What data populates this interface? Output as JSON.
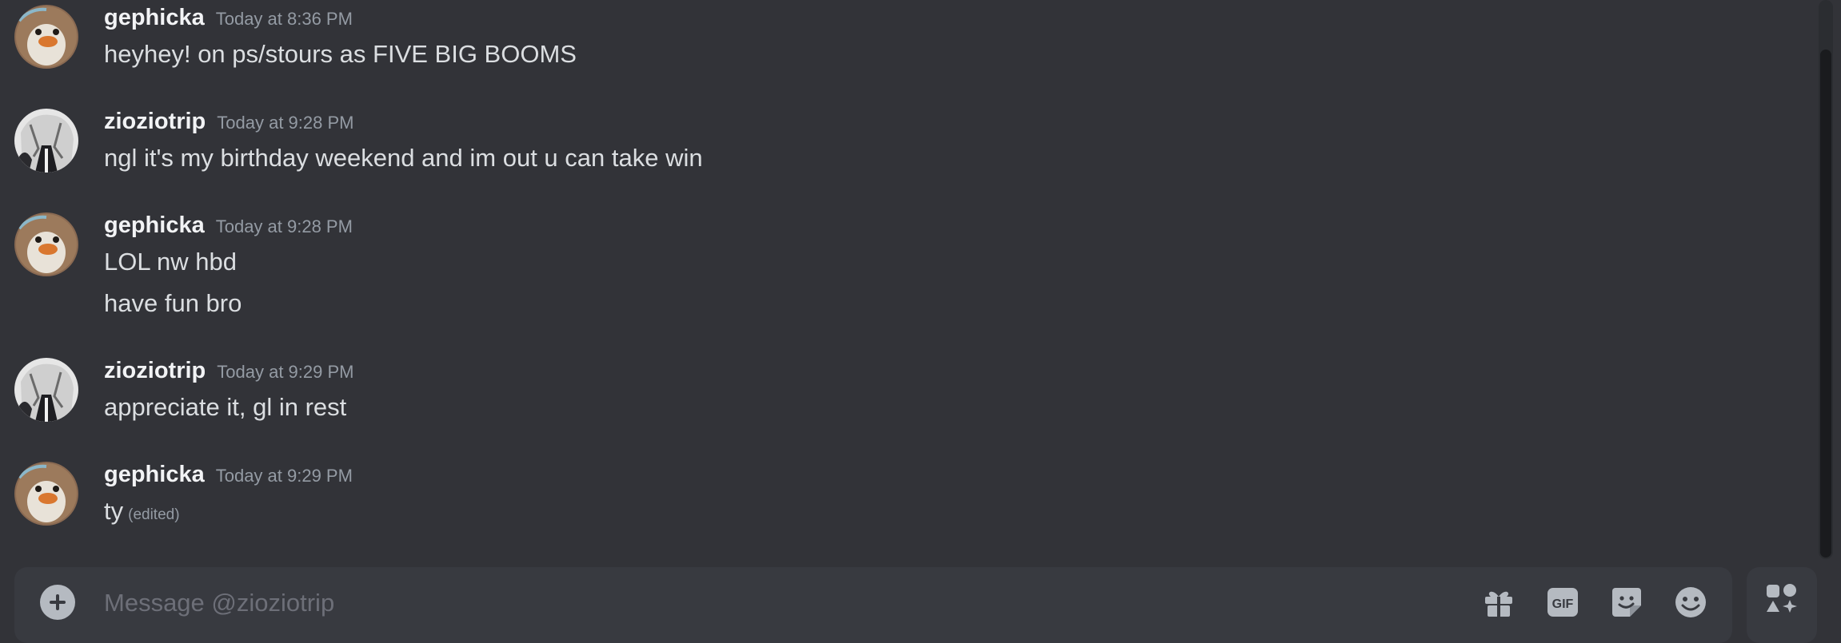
{
  "messages": [
    {
      "username": "gephicka",
      "timestamp": "Today at 8:36 PM",
      "lines": [
        "heyhey! on ps/stours as FIVE BIG BOOMS"
      ],
      "edited": ""
    },
    {
      "username": "zioziotrip",
      "timestamp": "Today at 9:28 PM",
      "lines": [
        "ngl it's my birthday weekend and im out u can take win"
      ],
      "edited": ""
    },
    {
      "username": "gephicka",
      "timestamp": "Today at 9:28 PM",
      "lines": [
        "LOL nw hbd",
        "have fun bro"
      ],
      "edited": ""
    },
    {
      "username": "zioziotrip",
      "timestamp": "Today at 9:29 PM",
      "lines": [
        "appreciate it, gl in rest"
      ],
      "edited": ""
    },
    {
      "username": "gephicka",
      "timestamp": "Today at 9:29 PM",
      "lines": [
        "ty"
      ],
      "edited": "(edited)"
    }
  ],
  "composer": {
    "placeholder": "Message @zioziotrip",
    "gif_label": "GIF"
  },
  "icons": {
    "attach": "plus-circle-icon",
    "gift": "gift-icon",
    "gif": "gif-icon",
    "sticker": "sticker-icon",
    "emoji": "emoji-icon",
    "apps": "apps-icon"
  },
  "colors": {
    "background": "#323338",
    "composer": "#383a40",
    "username": "#f2f3f5",
    "timestamp": "#949ba4",
    "icon": "#b5bac1"
  }
}
